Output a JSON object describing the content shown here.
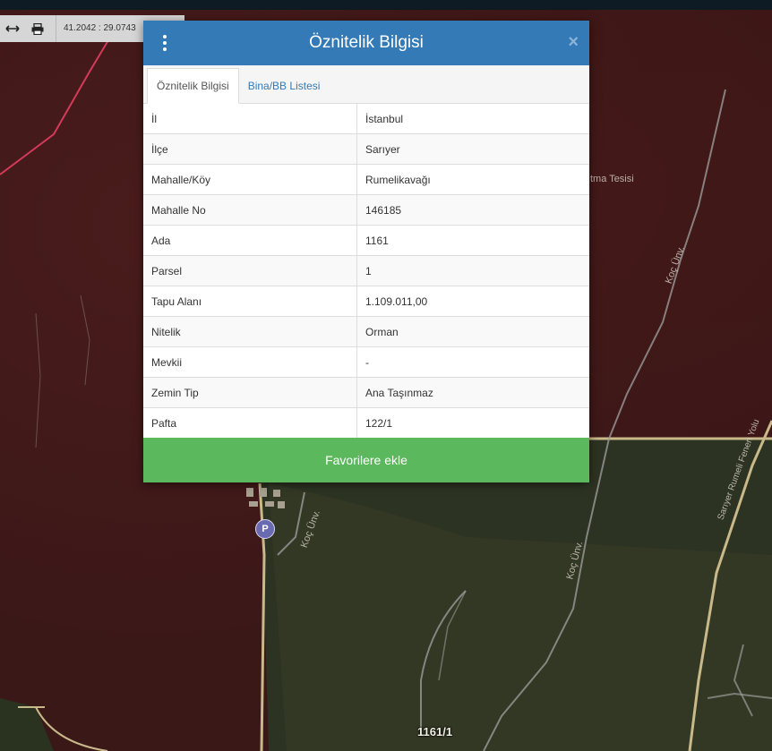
{
  "toolbar": {
    "coords": "41.2042 : 29.0743"
  },
  "map": {
    "labels": {
      "facility": "tma Tesisi",
      "road1": "Koç Ünv.",
      "road2": "Koç Ünv.",
      "road3": "Koç Ünv.",
      "road4": "Sarıyer Rumeli Feneri Yolu"
    },
    "parking": "P",
    "parcel": "1161/1"
  },
  "modal": {
    "title": "Öznitelik Bilgisi",
    "close": "×",
    "tabs": [
      {
        "label": "Öznitelik Bilgisi",
        "active": true
      },
      {
        "label": "Bina/BB Listesi",
        "active": false
      }
    ],
    "rows": [
      {
        "key": "İl",
        "value": "İstanbul"
      },
      {
        "key": "İlçe",
        "value": "Sarıyer"
      },
      {
        "key": "Mahalle/Köy",
        "value": "Rumelikavağı"
      },
      {
        "key": "Mahalle No",
        "value": "146185"
      },
      {
        "key": "Ada",
        "value": "1161"
      },
      {
        "key": "Parsel",
        "value": "1"
      },
      {
        "key": "Tapu Alanı",
        "value": "1.109.011,00"
      },
      {
        "key": "Nitelik",
        "value": "Orman"
      },
      {
        "key": "Mevkii",
        "value": "-"
      },
      {
        "key": "Zemin Tip",
        "value": "Ana Taşınmaz"
      },
      {
        "key": "Pafta",
        "value": "122/1"
      }
    ],
    "favorite_button": "Favorilere ekle"
  }
}
